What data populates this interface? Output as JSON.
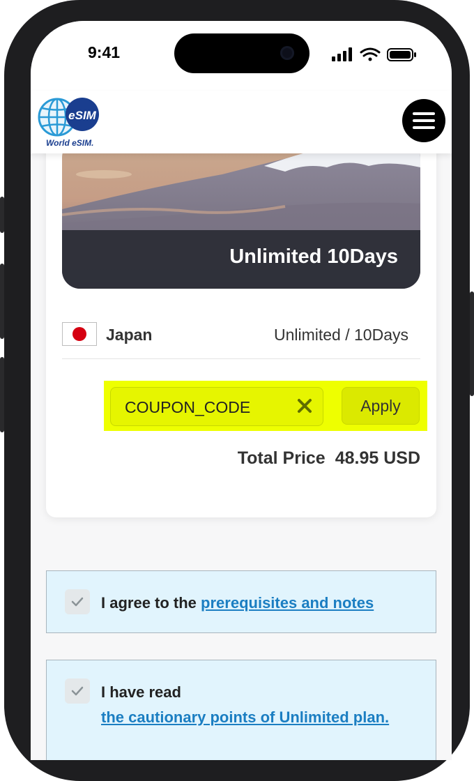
{
  "statusbar": {
    "time": "9:41"
  },
  "header": {
    "logo_badge": "eSIM",
    "logo_text": "World eSIM."
  },
  "product": {
    "banner_title": "Unlimited 10Days",
    "country": "Japan",
    "plan": "Unlimited / 10Days"
  },
  "coupon": {
    "value": "COUPON_CODE",
    "apply_label": "Apply",
    "highlight_color": "#eeff00"
  },
  "total": {
    "label": "Total Price",
    "amount": "48.95 USD"
  },
  "agreements": [
    {
      "prefix": "I agree to the",
      "link": "prerequisites and notes"
    },
    {
      "prefix": "I have read",
      "link": "the cautionary points of Unlimited plan."
    }
  ],
  "colors": {
    "link": "#1b7ec2",
    "agree_background": "#e1f4fd",
    "brand_blue": "#1a3e8f"
  }
}
